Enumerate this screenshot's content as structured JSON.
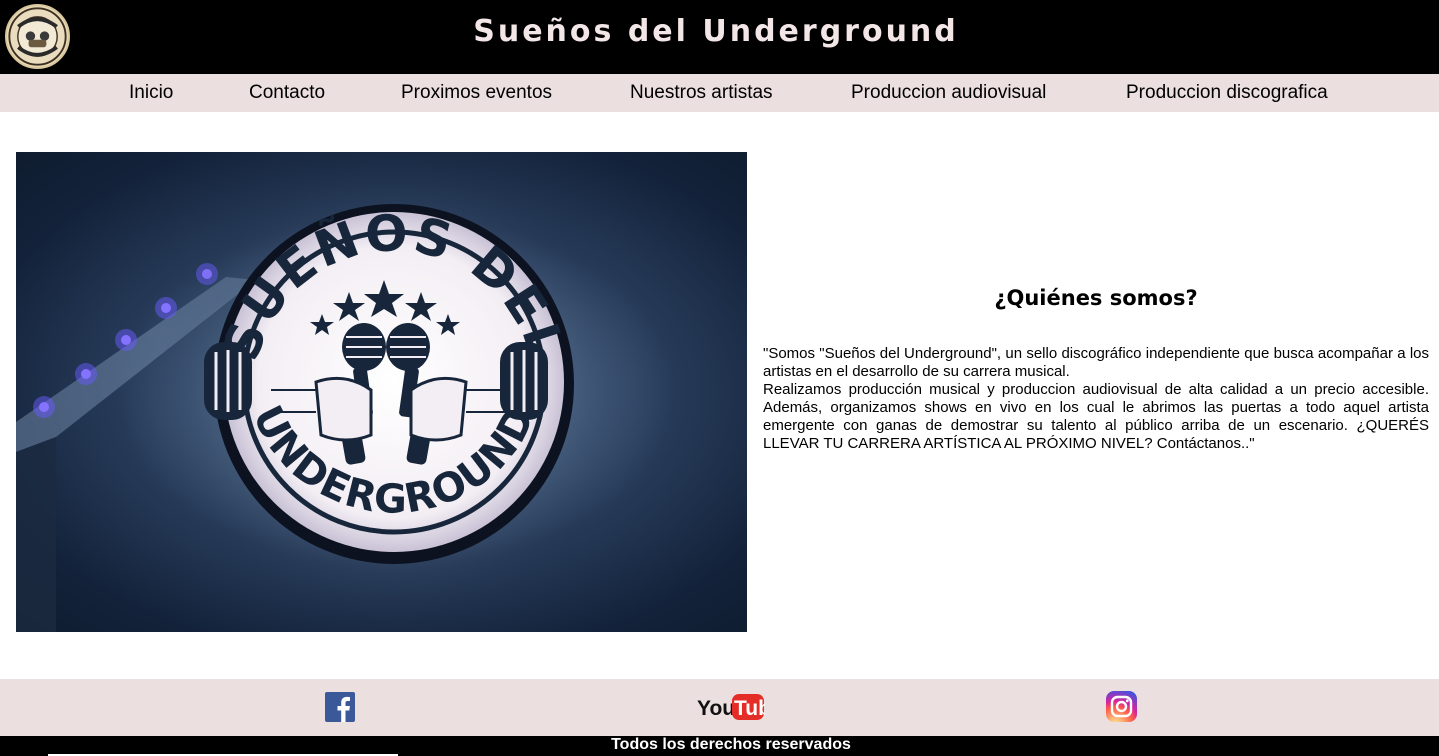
{
  "header": {
    "title": "Sueños del Underground",
    "logo_icon": "sdu-logo-badge"
  },
  "nav": {
    "items": [
      {
        "label": "Inicio"
      },
      {
        "label": "Contacto"
      },
      {
        "label": "Proximos eventos"
      },
      {
        "label": "Nuestros artistas"
      },
      {
        "label": "Produccion audiovisual"
      },
      {
        "label": "Produccion discografica"
      }
    ]
  },
  "hero": {
    "sign_line_top": "SUEÑOS DEL",
    "sign_line_bottom": "UNDERGROUND"
  },
  "about": {
    "heading": "¿Quiénes somos?",
    "paragraph_1": "\"Somos \"Sueños del Underground\", un sello discográfico independiente que busca acompañar a los artistas en el desarrollo de su carrera musical.",
    "paragraph_2": "Realizamos producción musical y produccion audiovisual de alta calidad a un precio accesible. Además, organizamos shows en vivo en los cual le abrimos las puertas a todo aquel artista emergente con ganas de demostrar su talento al público arriba de un escenario. ¿QUERÉS LLEVAR TU CARRERA ARTÍSTICA AL PRÓXIMO NIVEL? Contáctanos..\""
  },
  "footer": {
    "social": [
      {
        "name": "facebook-icon"
      },
      {
        "name": "youtube-icon"
      },
      {
        "name": "instagram-icon"
      }
    ],
    "copyright": "Todos los derechos reservados"
  },
  "colors": {
    "header_bg": "#000000",
    "nav_bg": "#ebdfdf",
    "footer_bg": "#ebdfdf",
    "title_color": "#f3e6e6"
  }
}
